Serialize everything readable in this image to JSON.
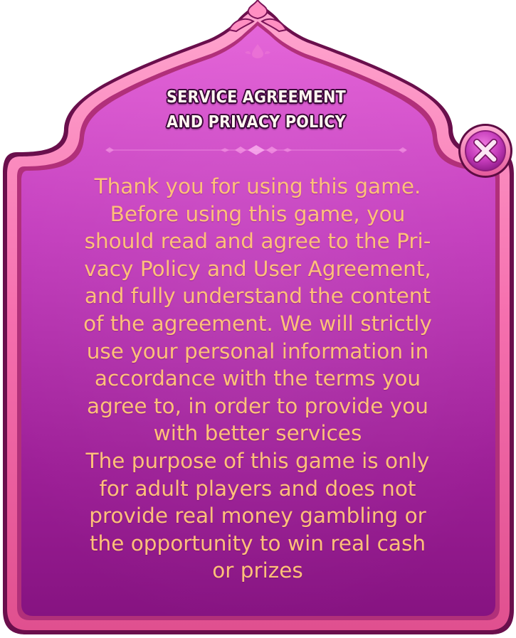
{
  "dialog": {
    "title_line1": "SERVICE AGREEMENT",
    "title_line2": "AND PRIVACY POLICY",
    "paragraph1_lines": [
      "Thank you for using this game.",
      "Before using this game, you",
      "should read and agree to the Pri-",
      "vacy Policy and User Agreement,",
      "and fully understand the content",
      "of the agreement. We will strictly",
      "use your personal information in",
      "accordance with the terms you",
      "agree to, in order to provide you",
      "with better services"
    ],
    "paragraph2_lines": [
      "The purpose of this game is only",
      "for adult players and does not",
      "provide real money gambling or",
      "the opportunity to win real cash",
      "or prizes"
    ]
  },
  "close_button": {
    "icon": "close-icon"
  },
  "colors": {
    "panel_top": "#e35fd6",
    "panel_bottom": "#8a1783",
    "border_pink": "#ff7fb8",
    "title_text": "#fff6f0",
    "body_text": "#ffc07a"
  }
}
